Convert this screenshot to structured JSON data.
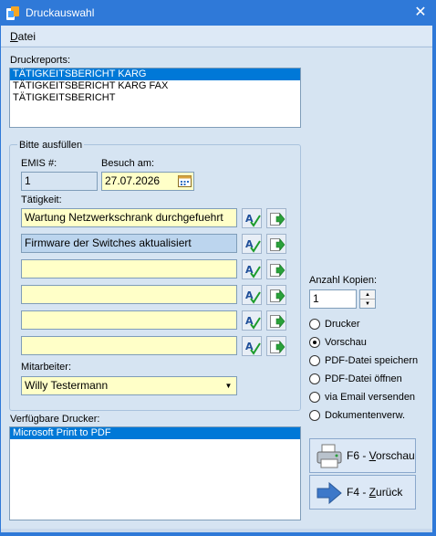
{
  "window": {
    "title": "Druckauswahl"
  },
  "menu": {
    "datei": "Datei",
    "datei_hotkey": "D",
    "datei_rest": "atei"
  },
  "reports": {
    "label": "Druckreports:",
    "items": [
      "TÄTIGKEITSBERICHT  KARG",
      "TÄTIGKEITSBERICHT KARG FAX",
      "TÄTIGKEITSBERICHT"
    ]
  },
  "form": {
    "group_title": "Bitte ausfüllen",
    "emis_label": "EMIS #:",
    "emis_value": "1",
    "besuch_label": "Besuch am:",
    "besuch_value": "27.07.2026",
    "taetigkeit_label": "Tätigkeit:",
    "taetigkeiten": [
      "Wartung Netzwerkschrank durchgefuehrt",
      "Firmware der Switches aktualisiert",
      "",
      "",
      "",
      ""
    ],
    "mitarbeiter_label": "Mitarbeiter:",
    "mitarbeiter_value": "Willy Testermann"
  },
  "printers": {
    "label": "Verfügbare Drucker:",
    "items": [
      "Microsoft Print to PDF"
    ]
  },
  "copies": {
    "label": "Anzahl Kopien:",
    "value": "1"
  },
  "output": {
    "options": [
      "Drucker",
      "Vorschau",
      "PDF-Datei speichern",
      "PDF-Datei öffnen",
      "via Email versenden",
      "Dokumentenverw."
    ],
    "selected": "Vorschau"
  },
  "buttons": {
    "vorschau_prefix": "F6 - ",
    "vorschau_hot": "V",
    "vorschau_rest": "orschau",
    "zurueck_prefix": "F4 - ",
    "zurueck_hot": "Z",
    "zurueck_rest": "urück"
  },
  "colors": {
    "titlebar": "#2f79d8",
    "selection": "#0078d7",
    "input_yellow": "#ffffc8"
  }
}
